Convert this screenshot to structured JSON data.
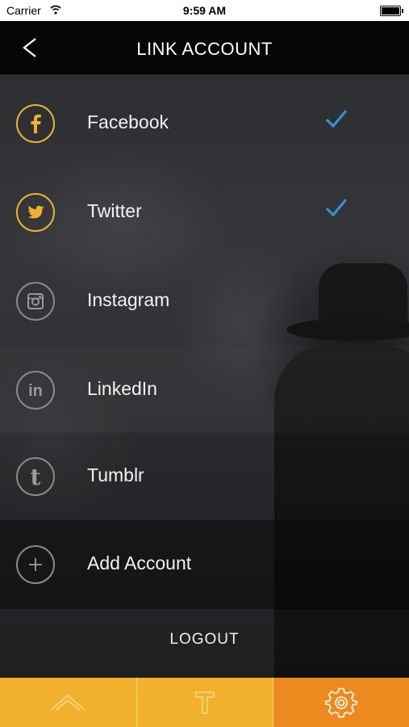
{
  "status_bar": {
    "carrier": "Carrier",
    "time": "9:59 AM"
  },
  "nav": {
    "title": "LINK ACCOUNT"
  },
  "accounts": [
    {
      "label": "Facebook",
      "icon": "facebook-icon",
      "linked": true
    },
    {
      "label": "Twitter",
      "icon": "twitter-icon",
      "linked": true
    },
    {
      "label": "Instagram",
      "icon": "instagram-icon",
      "linked": false
    },
    {
      "label": "LinkedIn",
      "icon": "linkedin-icon",
      "linked": false
    },
    {
      "label": "Tumblr",
      "icon": "tumblr-icon",
      "linked": false
    },
    {
      "label": "Add Account",
      "icon": "plus-icon",
      "linked": false
    }
  ],
  "logout_label": "LOGOUT",
  "tabbar": {
    "tabs": [
      "home-icon",
      "t-icon",
      "gear-icon"
    ],
    "active": 2
  },
  "colors": {
    "accent": "#f2b12c",
    "active_tab": "#ec8a1f",
    "check": "#3a8fd0"
  }
}
